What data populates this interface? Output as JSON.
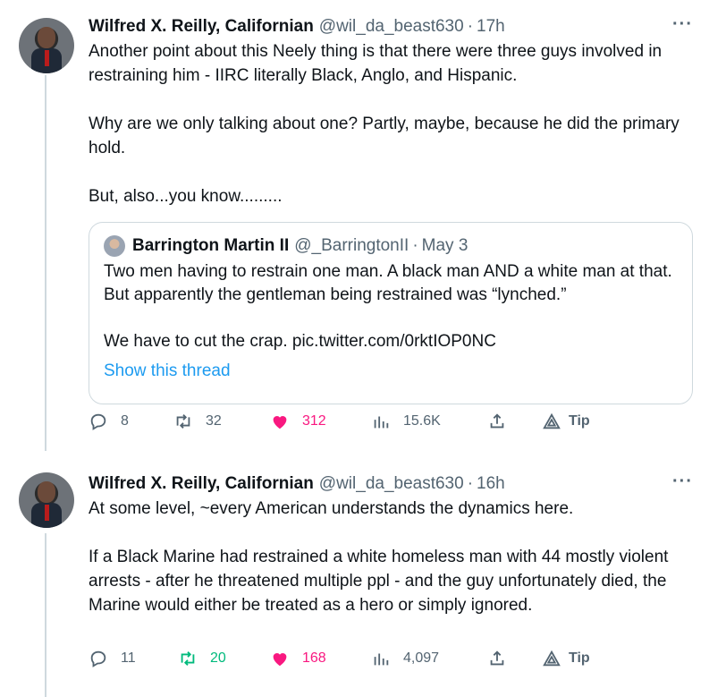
{
  "tweets": [
    {
      "author_name": "Wilfred X. Reilly, Californian",
      "handle": "@wil_da_beast630",
      "separator": "·",
      "time": "17h",
      "more": "···",
      "paragraphs": [
        "Another point about this Neely thing is that there were three guys involved in restraining him - IIRC literally Black, Anglo, and Hispanic.",
        "Why are we only talking about one? Partly, maybe, because he did the primary hold.",
        "But, also...you know........."
      ],
      "quote": {
        "author_name": "Barrington Martin II",
        "handle": "@_BarringtonII",
        "separator": "·",
        "date": "May 3",
        "paragraphs": [
          "Two men having to restrain one man. A black man AND a white man at that. But apparently the gentleman being restrained was “lynched.”",
          "We have to cut the crap. pic.twitter.com/0rktIOP0NC"
        ],
        "show_thread": "Show this thread"
      },
      "actions": {
        "replies": "8",
        "retweets": "32",
        "likes": "312",
        "views": "15.6K",
        "tip": "Tip"
      }
    },
    {
      "author_name": "Wilfred X. Reilly, Californian",
      "handle": "@wil_da_beast630",
      "separator": "·",
      "time": "16h",
      "more": "···",
      "paragraphs": [
        "At some level, ~every American understands the dynamics here.",
        "If a Black Marine had restrained a white homeless man with 44 mostly violent arrests - after he threatened multiple ppl - and the guy unfortunately died, the Marine would either be treated as a hero or simply ignored."
      ],
      "actions": {
        "replies": "11",
        "retweets": "20",
        "likes": "168",
        "views": "4,097",
        "tip": "Tip"
      }
    }
  ],
  "colors": {
    "like": "#f91880",
    "retweet": "#00ba7c",
    "link": "#1d9bf0",
    "muted": "#536471"
  },
  "icons": [
    "reply-icon",
    "retweet-icon",
    "heart-icon",
    "views-icon",
    "share-icon",
    "tip-icon",
    "more-icon"
  ]
}
